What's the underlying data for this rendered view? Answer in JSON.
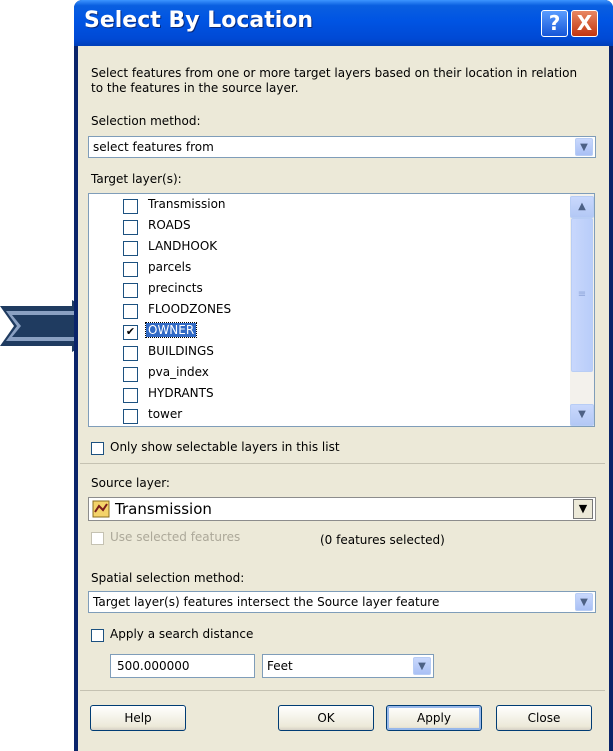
{
  "window": {
    "title": "Select By Location",
    "help_glyph": "?",
    "close_glyph": "X"
  },
  "description": "Select features from one or more target layers based on their location in relation to the features in the source layer.",
  "selection_method": {
    "label": "Selection method:",
    "value": "select features from"
  },
  "target_layers": {
    "label": "Target layer(s):",
    "items": [
      {
        "label": "Transmission",
        "checked": false
      },
      {
        "label": "ROADS",
        "checked": false
      },
      {
        "label": "LANDHOOK",
        "checked": false
      },
      {
        "label": "parcels",
        "checked": false
      },
      {
        "label": "precincts",
        "checked": false
      },
      {
        "label": "FLOODZONES",
        "checked": false
      },
      {
        "label": "OWNER",
        "checked": true,
        "selected": true
      },
      {
        "label": "BUILDINGS",
        "checked": false
      },
      {
        "label": "pva_index",
        "checked": false
      },
      {
        "label": "HYDRANTS",
        "checked": false
      },
      {
        "label": "tower",
        "checked": false
      }
    ]
  },
  "only_selectable": {
    "label": "Only show selectable layers in this list",
    "checked": false
  },
  "source_layer": {
    "label": "Source layer:",
    "value": "Transmission"
  },
  "use_selected": {
    "label": "Use selected features",
    "checked": false,
    "disabled": true,
    "count_text": "(0 features selected)"
  },
  "spatial_method": {
    "label": "Spatial selection method:",
    "value": "Target layer(s) features intersect the Source layer feature"
  },
  "search_distance": {
    "label": "Apply a search distance",
    "checked": false,
    "value": "500.000000",
    "unit": "Feet"
  },
  "buttons": {
    "help": "Help",
    "ok": "OK",
    "apply": "Apply",
    "close": "Close"
  },
  "glyphs": {
    "checkmark": "✔",
    "dropdown": "▼",
    "scroll_up": "▲",
    "scroll_down": "▼",
    "grip": "≡"
  },
  "colors": {
    "title_bar": "#0054e3",
    "dialog_bg": "#ece9d8",
    "selection": "#316ac5",
    "arrow": "#1f3b60"
  }
}
